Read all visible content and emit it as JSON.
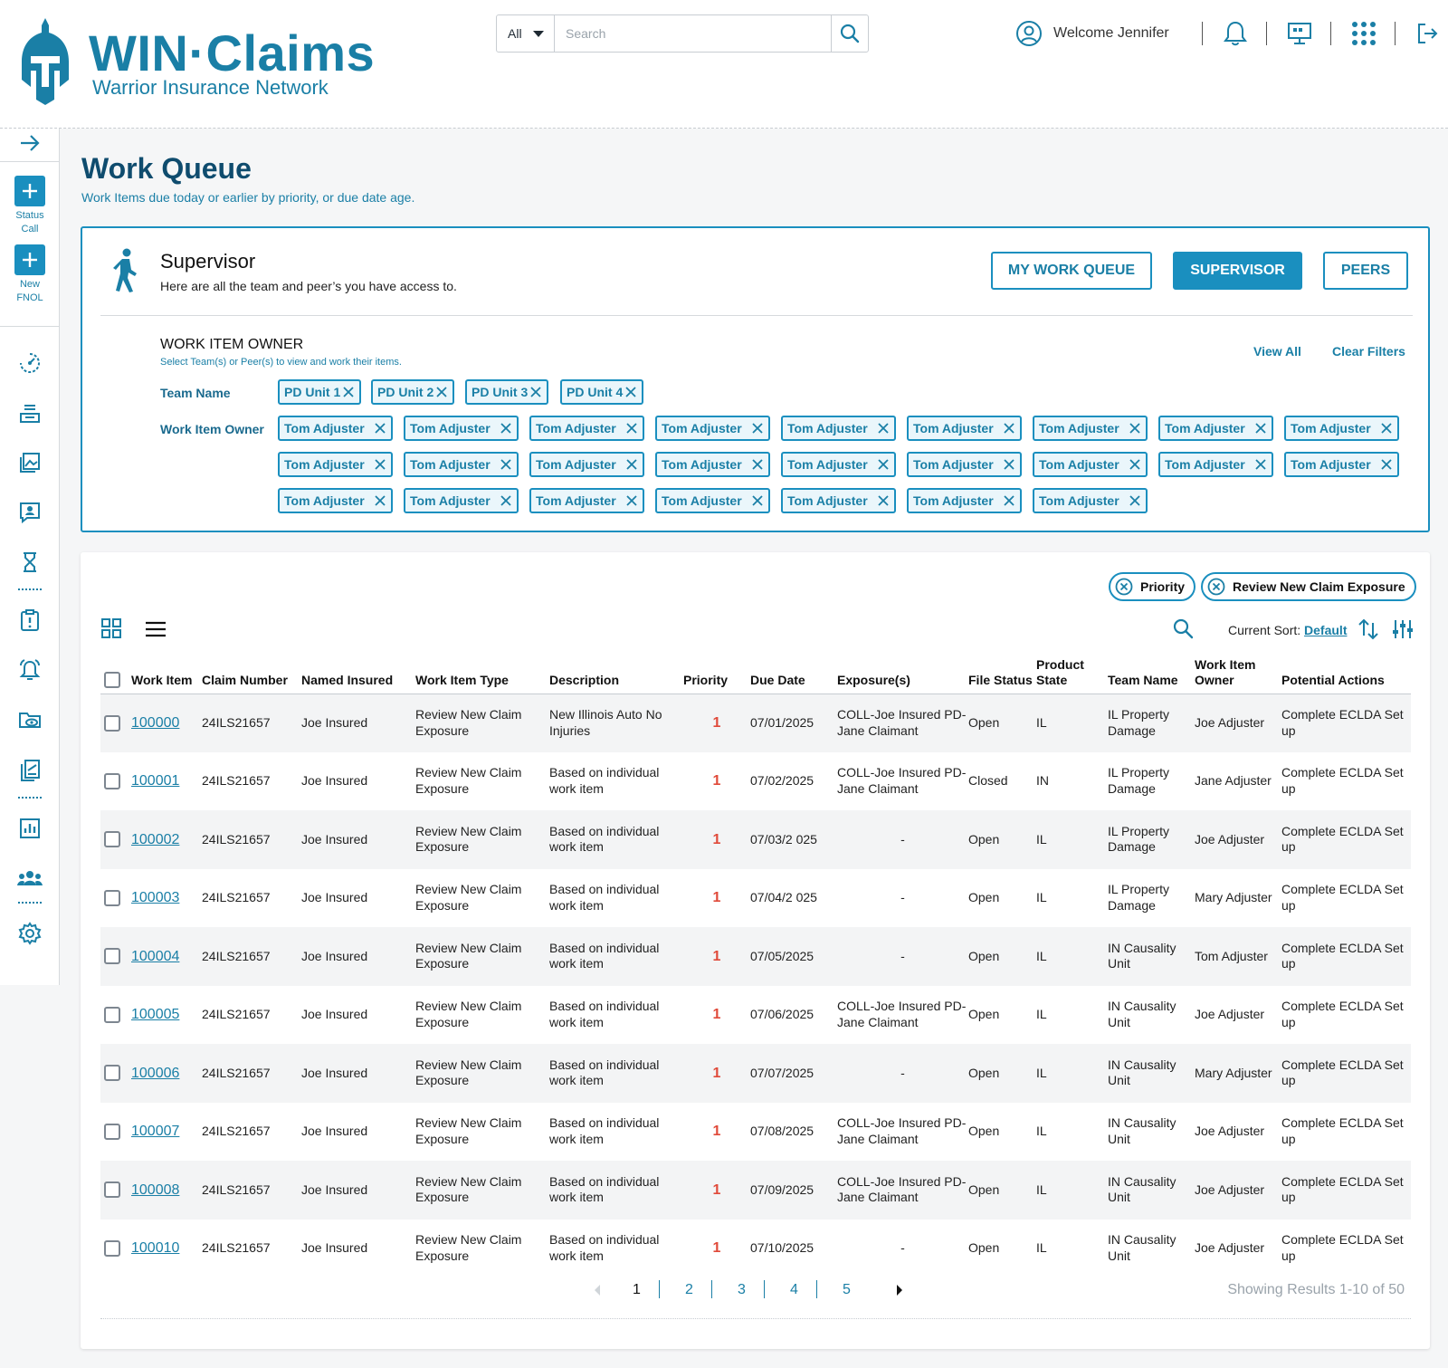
{
  "brand": {
    "title": "WIN·Claims",
    "subtitle": "Warrior Insurance Network"
  },
  "search": {
    "scope": "All",
    "placeholder": "Search"
  },
  "user": {
    "welcome": "Welcome Jennifer"
  },
  "icons": {
    "search": "search-icon",
    "user": "user-circle-icon",
    "bell": "bell-icon",
    "monitor": "monitor-icon",
    "apps": "apps-grid-icon",
    "logout": "logout-icon"
  },
  "rail": {
    "status_call": "Status\nCall",
    "new_fnol": "New\nFNOL"
  },
  "page": {
    "title": "Work Queue",
    "subtitle": "Work Items due today or earlier by priority, or due date age."
  },
  "supervisor": {
    "title": "Supervisor",
    "desc": "Here are all the team and peer’s you have access to.",
    "btn_my_queue": "MY WORK QUEUE",
    "btn_supervisor": "SUPERVISOR",
    "btn_peers": "PEERS",
    "owner_title": "WORK ITEM OWNER",
    "owner_sub": "Select Team(s) or Peer(s) to view and work their items.",
    "view_all": "View All",
    "clear_filters": "Clear Filters",
    "team_label": "Team Name",
    "owner_label": "Work Item Owner",
    "teams": [
      "PD Unit 1",
      "PD Unit 2",
      "PD Unit 3",
      "PD Unit 4"
    ],
    "owners": [
      "Tom Adjuster",
      "Tom Adjuster",
      "Tom Adjuster",
      "Tom Adjuster",
      "Tom Adjuster",
      "Tom Adjuster",
      "Tom Adjuster",
      "Tom Adjuster",
      "Tom Adjuster",
      "Tom Adjuster",
      "Tom Adjuster",
      "Tom Adjuster",
      "Tom Adjuster",
      "Tom Adjuster",
      "Tom Adjuster",
      "Tom Adjuster",
      "Tom Adjuster",
      "Tom Adjuster",
      "Tom Adjuster",
      "Tom Adjuster",
      "Tom Adjuster",
      "Tom Adjuster",
      "Tom Adjuster",
      "Tom Adjuster",
      "Tom Adjuster"
    ]
  },
  "filters": {
    "pill1": "Priority",
    "pill2": "Review New Claim Exposure"
  },
  "sort": {
    "label": "Current Sort:",
    "value": "Default"
  },
  "table": {
    "headers": {
      "work_item": "Work Item",
      "claim": "Claim Number",
      "insured": "Named Insured",
      "type": "Work Item Type",
      "desc": "Description",
      "priority": "Priority",
      "due": "Due Date",
      "exposure": "Exposure(s)",
      "status": "File Status",
      "state": "Product State",
      "team": "Team Name",
      "owner": "Work Item Owner",
      "actions": "Potential Actions"
    },
    "rows": [
      {
        "id": "100000",
        "claim": "24ILS21657",
        "insured": "Joe Insured",
        "type": "Review New Claim Exposure",
        "desc": "New Illinois Auto No Injuries",
        "priority": "1",
        "due": "07/01/2025",
        "exposure": "COLL-Joe Insured PD- Jane Claimant",
        "status": "Open",
        "state": "IL",
        "team": "IL Property Damage",
        "owner": "Joe Adjuster",
        "action": "Complete ECLDA Set up"
      },
      {
        "id": "100001",
        "claim": "24ILS21657",
        "insured": "Joe Insured",
        "type": "Review New Claim Exposure",
        "desc": "Based on individual work item",
        "priority": "1",
        "due": "07/02/2025",
        "exposure": "COLL-Joe Insured PD- Jane Claimant",
        "status": "Closed",
        "state": "IN",
        "team": "IL Property Damage",
        "owner": "Jane Adjuster",
        "action": "Complete ECLDA Set up"
      },
      {
        "id": "100002",
        "claim": "24ILS21657",
        "insured": "Joe Insured",
        "type": "Review New Claim Exposure",
        "desc": "Based on individual work item",
        "priority": "1",
        "due": "07/03/2 025",
        "exposure": "-",
        "status": "Open",
        "state": "IL",
        "team": "IL Property Damage",
        "owner": "Joe Adjuster",
        "action": "Complete ECLDA Set up"
      },
      {
        "id": "100003",
        "claim": "24ILS21657",
        "insured": "Joe Insured",
        "type": "Review New Claim Exposure",
        "desc": "Based on individual work item",
        "priority": "1",
        "due": "07/04/2 025",
        "exposure": "-",
        "status": "Open",
        "state": "IL",
        "team": "IL Property Damage",
        "owner": "Mary Adjuster",
        "action": "Complete ECLDA Set up"
      },
      {
        "id": "100004",
        "claim": "24ILS21657",
        "insured": "Joe Insured",
        "type": "Review New Claim Exposure",
        "desc": "Based on individual work item",
        "priority": "1",
        "due": "07/05/2025",
        "exposure": "-",
        "status": "Open",
        "state": "IL",
        "team": "IN Causality Unit",
        "owner": "Tom Adjuster",
        "action": "Complete ECLDA Set up"
      },
      {
        "id": "100005",
        "claim": "24ILS21657",
        "insured": "Joe Insured",
        "type": "Review New Claim Exposure",
        "desc": "Based on individual work item",
        "priority": "1",
        "due": "07/06/2025",
        "exposure": "COLL-Joe Insured PD- Jane Claimant",
        "status": "Open",
        "state": "IL",
        "team": "IN Causality Unit",
        "owner": "Joe Adjuster",
        "action": "Complete ECLDA Set up"
      },
      {
        "id": "100006",
        "claim": "24ILS21657",
        "insured": "Joe Insured",
        "type": "Review New Claim Exposure",
        "desc": "Based on individual work item",
        "priority": "1",
        "due": "07/07/2025",
        "exposure": "-",
        "status": "Open",
        "state": "IL",
        "team": "IN Causality Unit",
        "owner": "Mary Adjuster",
        "action": "Complete ECLDA Set up"
      },
      {
        "id": "100007",
        "claim": "24ILS21657",
        "insured": "Joe Insured",
        "type": "Review New Claim Exposure",
        "desc": "Based on individual work item",
        "priority": "1",
        "due": "07/08/2025",
        "exposure": "COLL-Joe Insured PD- Jane Claimant",
        "status": "Open",
        "state": "IL",
        "team": "IN Causality Unit",
        "owner": "Joe Adjuster",
        "action": "Complete ECLDA Set up"
      },
      {
        "id": "100008",
        "claim": "24ILS21657",
        "insured": "Joe Insured",
        "type": "Review New Claim Exposure",
        "desc": "Based on individual work item",
        "priority": "1",
        "due": "07/09/2025",
        "exposure": "COLL-Joe Insured PD- Jane Claimant",
        "status": "Open",
        "state": "IL",
        "team": "IN Causality Unit",
        "owner": "Joe Adjuster",
        "action": "Complete ECLDA Set up"
      },
      {
        "id": "100010",
        "claim": "24ILS21657",
        "insured": "Joe Insured",
        "type": "Review New Claim Exposure",
        "desc": "Based on individual work item",
        "priority": "1",
        "due": "07/10/2025",
        "exposure": "-",
        "status": "Open",
        "state": "IL",
        "team": "IN Causality Unit",
        "owner": "Joe Adjuster",
        "action": "Complete ECLDA Set up"
      }
    ]
  },
  "pagination": {
    "pages": [
      "1",
      "2",
      "3",
      "4",
      "5"
    ],
    "current": "1",
    "results": "Showing Results 1-10 of 50"
  },
  "colors": {
    "accent": "#1a8fbf",
    "accent_dark": "#0f4c6e",
    "priority": "#e04a3a"
  }
}
